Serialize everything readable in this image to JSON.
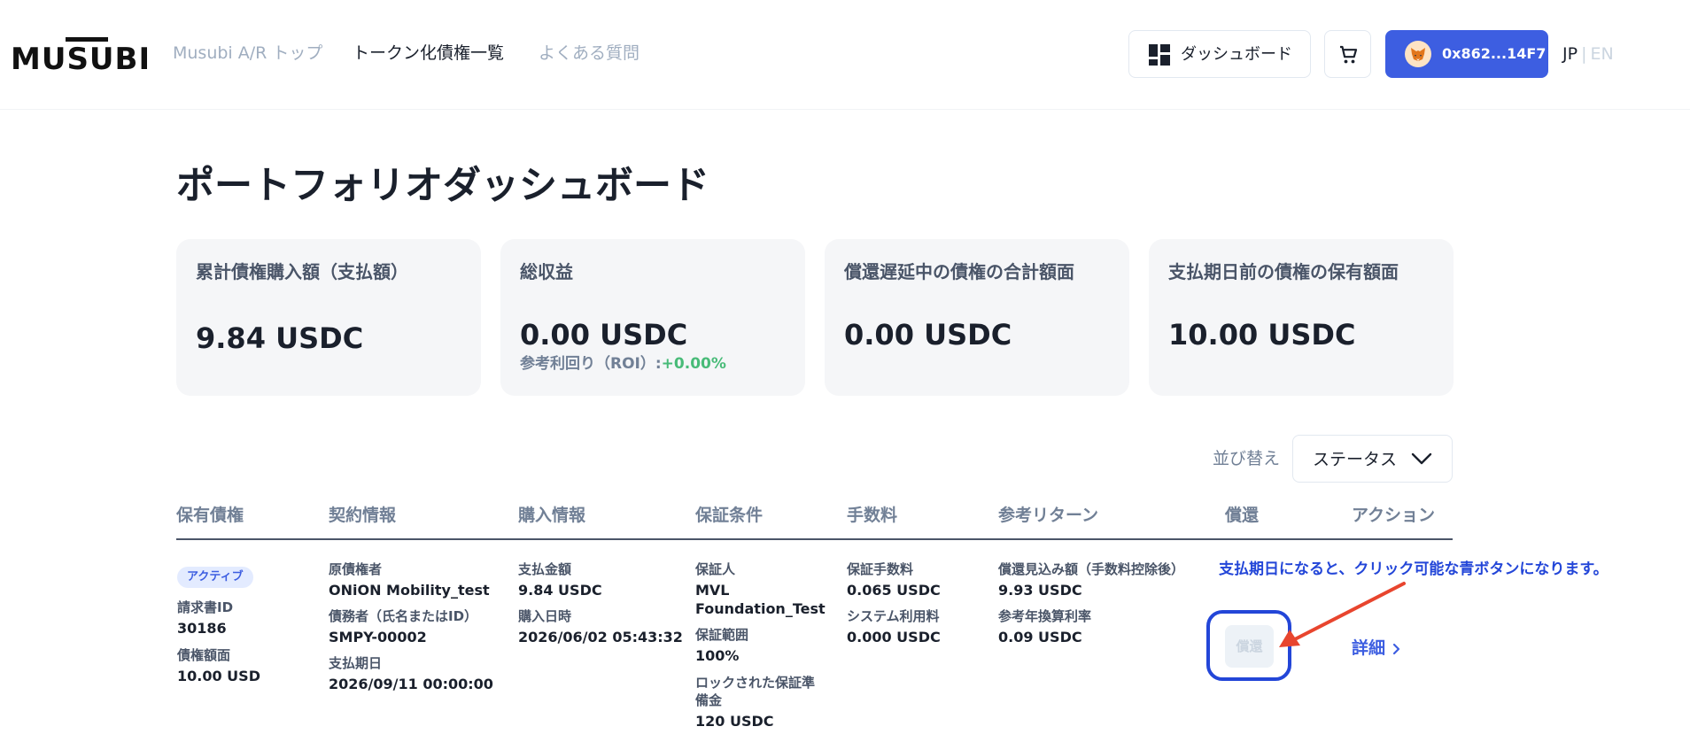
{
  "header": {
    "logo": "MUSUBI",
    "nav": [
      "Musubi A/R トップ",
      "トークン化債権一覧",
      "よくある質問"
    ],
    "dashboard_label": "ダッシュボード",
    "wallet_label": "0x862...14F7",
    "lang_jp": "JP",
    "lang_sep": "|",
    "lang_en": "EN"
  },
  "page": {
    "title": "ポートフォリオダッシュボード"
  },
  "cards": [
    {
      "label": "累計債権購入額（支払額）",
      "value": "9.84 USDC"
    },
    {
      "label": "総収益",
      "value": "0.00 USDC",
      "sub_label": "参考利回り（ROI）:",
      "sub_value": "+0.00%"
    },
    {
      "label": "償還遅延中の債権の合計額面",
      "value": "0.00 USDC"
    },
    {
      "label": "支払期日前の債権の保有額面",
      "value": "10.00 USDC"
    }
  ],
  "sort": {
    "label": "並び替え",
    "value": "ステータス"
  },
  "table": {
    "headers": [
      "保有債権",
      "契約情報",
      "購入情報",
      "保証条件",
      "手数料",
      "参考リターン",
      "償還",
      "アクション"
    ],
    "row": {
      "status": "アクティブ",
      "invoice_id_label": "請求書ID",
      "invoice_id": "30186",
      "face_value_label": "債権額面",
      "face_value": "10.00 USD",
      "creditor_label": "原債権者",
      "creditor": "ONiON Mobility_test",
      "debtor_label": "債務者（氏名またはID）",
      "debtor": "SMPY-00002",
      "due_date_label": "支払期日",
      "due_date": "2026/09/11 00:00:00",
      "paid_label": "支払金額",
      "paid": "9.84 USDC",
      "purchase_date_label": "購入日時",
      "purchase_date": "2026/06/02 05:43:32",
      "guarantor_label": "保証人",
      "guarantor_line1": "MVL",
      "guarantor_line2": "Foundation_Test",
      "coverage_label": "保証範囲",
      "coverage": "100%",
      "locked_label_line1": "ロックされた保証準",
      "locked_label_line2": "備金",
      "locked": "120 USDC",
      "guarantee_fee_label": "保証手数料",
      "guarantee_fee": "0.065 USDC",
      "system_fee_label": "システム利用料",
      "system_fee": "0.000 USDC",
      "expected_label": "償還見込み額（手数料控除後）",
      "expected": "9.93 USDC",
      "apr_label": "参考年換算利率",
      "apr": "0.09 USDC",
      "redeem_label": "償還",
      "detail_label": "詳細"
    }
  },
  "annotation": "支払期日になると、クリック可能な青ボタンになります。",
  "colors": {
    "accent": "#3d5ee1",
    "annotation": "#2346d8",
    "arrow": "#e8452e",
    "positive": "#48bb78"
  }
}
